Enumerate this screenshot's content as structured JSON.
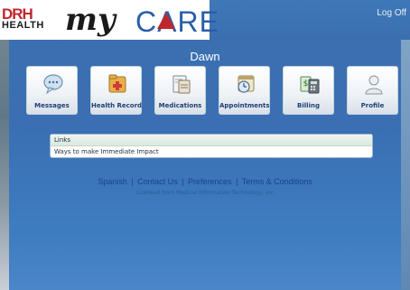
{
  "header": {
    "logo": {
      "drh": "DRH",
      "health": "HEALTH",
      "my": "my",
      "care": "CARE"
    },
    "logoff_label": "Log Off"
  },
  "user": {
    "name": "Dawn"
  },
  "tiles": [
    {
      "label": "Messages",
      "icon": "speech-bubble-icon"
    },
    {
      "label": "Health Record",
      "icon": "medical-folder-icon"
    },
    {
      "label": "Medications",
      "icon": "prescription-icon"
    },
    {
      "label": "Appointments",
      "icon": "calendar-clock-icon"
    },
    {
      "label": "Billing",
      "icon": "calculator-icon"
    },
    {
      "label": "Profile",
      "icon": "person-icon"
    }
  ],
  "links": {
    "header": "Links",
    "items": [
      "Ways to make Immediate Impact"
    ]
  },
  "footer": {
    "links": [
      "Spanish",
      "Contact Us",
      "Preferences",
      "Terms & Conditions"
    ],
    "separator": "|",
    "license": "Licensed from Medical Information Technology, Inc"
  },
  "colors": {
    "background": "#3b6fb0",
    "accent_red": "#c0272d",
    "brand_blue": "#2a5ea8",
    "tile_label": "#1f3f75"
  }
}
